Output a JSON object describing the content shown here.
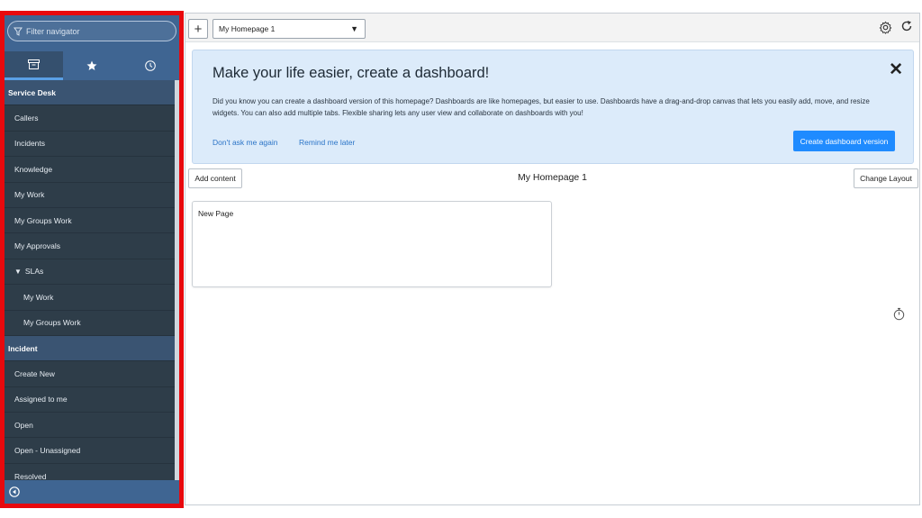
{
  "sidebar": {
    "filter_placeholder": "Filter navigator",
    "tabs": [
      {
        "icon": "archive-icon"
      },
      {
        "icon": "star-icon"
      },
      {
        "icon": "clock-icon"
      }
    ],
    "sections": [
      {
        "title": "Service Desk"
      },
      {
        "title": "Incident"
      }
    ],
    "items": {
      "callers": "Callers",
      "incidents": "Incidents",
      "knowledge": "Knowledge",
      "my_work": "My Work",
      "my_groups_work": "My Groups Work",
      "my_approvals": "My Approvals",
      "slas": "SLAs",
      "slas_my_work": "My Work",
      "slas_my_groups_work": "My Groups Work",
      "create_new": "Create New",
      "assigned_to_me": "Assigned to me",
      "open": "Open",
      "open_unassigned": "Open - Unassigned",
      "resolved": "Resolved"
    },
    "colors": {
      "header": "#3f6592",
      "background": "#2e3d49",
      "section": "#3a5472",
      "highlight_border": "#e8090d"
    }
  },
  "toolbar": {
    "add_label": "+",
    "homepage_selected": "My Homepage 1"
  },
  "banner": {
    "title": "Make your life easier, create a dashboard!",
    "body": "Did you know you can create a dashboard version of this homepage? Dashboards are like homepages, but easier to use. Dashboards have a drag-and-drop canvas that lets you easily add, move, and resize widgets. You can also add multiple tabs. Flexible sharing lets any user view and collaborate on dashboards with you!",
    "dont_ask": "Don't ask me again",
    "remind_later": "Remind me later",
    "create_button": "Create dashboard version",
    "close": "✕",
    "colors": {
      "background": "#dcebfa",
      "button": "#1f8bff",
      "link": "#2b74c7"
    }
  },
  "content": {
    "add_content": "Add content",
    "homepage_title": "My Homepage 1",
    "change_layout": "Change Layout",
    "widget_title": "New Page"
  }
}
